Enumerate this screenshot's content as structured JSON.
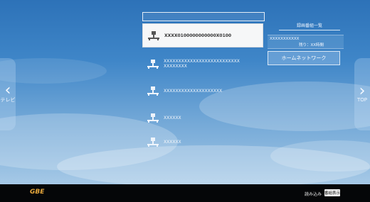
{
  "nav": {
    "left_label": "テレビ",
    "right_label": "TOP"
  },
  "file_list": {
    "items": [
      {
        "name": "XXXX0100000000000X0100",
        "selected": true
      },
      {
        "name": "XXXXXXXXXXXXXXXXXXXXXXXXXXXXXXXXXX",
        "selected": false
      },
      {
        "name": "XXXXXXXXXXXXXXXXXXXX",
        "selected": false
      },
      {
        "name": "XXXXXX",
        "selected": false
      },
      {
        "name": "XXXXXX",
        "selected": false
      }
    ]
  },
  "info_panel": {
    "title": "録画番組一覧",
    "id_text": "XXXXXXXXXXX",
    "remaining_text": "残り：XX時間",
    "home_network_label": "ホームネットワーク"
  },
  "bottom_bar": {
    "logo_text": "GBE",
    "read_label": "読み込み",
    "key_label": "番組表示"
  },
  "colors": {
    "background_top": "#2d72b8",
    "background_bottom": "#b7d3ec",
    "selected_item": "#f6f7f8",
    "bottom_bar": "#050608",
    "logo": "#e8a83c"
  }
}
